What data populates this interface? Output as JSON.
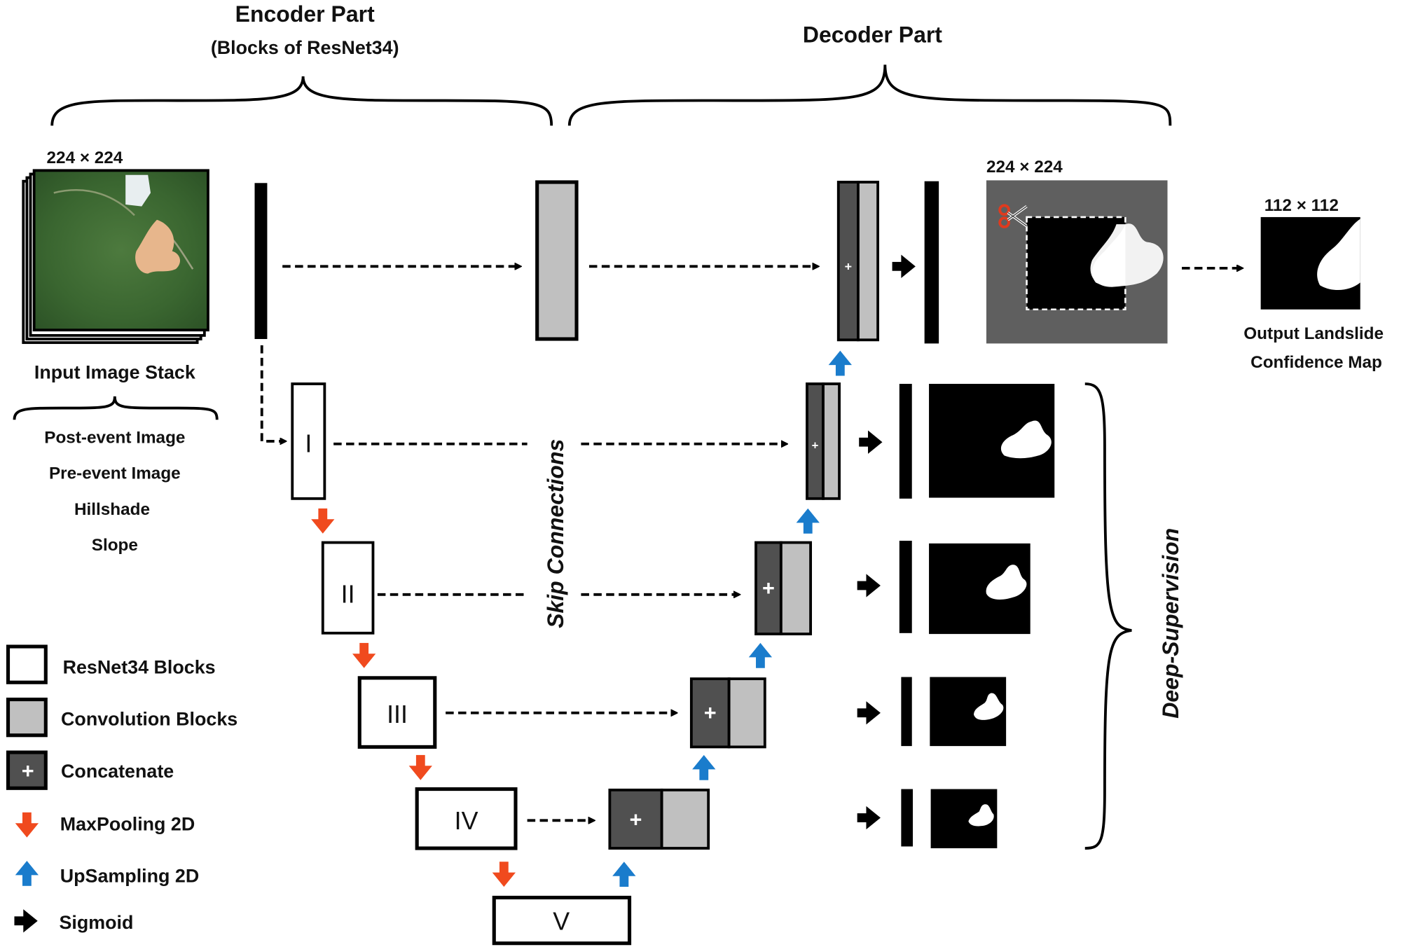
{
  "encoder": {
    "title": "Encoder Part",
    "subtitle": "(Blocks of ResNet34)"
  },
  "decoder": {
    "title": "Decoder Part"
  },
  "input": {
    "size": "224 × 224",
    "label": "Input Image Stack",
    "layers": [
      "Post-event Image",
      "Pre-event Image",
      "Hillshade",
      "Slope"
    ]
  },
  "encoder_blocks": [
    "I",
    "II",
    "III",
    "IV",
    "V"
  ],
  "skip_label": "Skip Connections",
  "deep_supervision_label": "Deep-Supervision",
  "crop": {
    "size": "224 × 224",
    "icon": "scissors-icon"
  },
  "output": {
    "size": "112 × 112",
    "label_line1": "Output Landslide",
    "label_line2": "Confidence Map"
  },
  "concat_symbol": "+",
  "legend": [
    {
      "label": "ResNet34 Blocks",
      "icon": "white-box"
    },
    {
      "label": "Convolution Blocks",
      "icon": "gray-box"
    },
    {
      "label": "Concatenate",
      "icon": "dark-box-plus"
    },
    {
      "label": "MaxPooling 2D",
      "icon": "red-down-arrow"
    },
    {
      "label": "UpSampling 2D",
      "icon": "blue-up-arrow"
    },
    {
      "label": "Sigmoid",
      "icon": "black-right-arrow"
    }
  ],
  "colors": {
    "maxpool": "#f04a1e",
    "upsample": "#1a7ccc",
    "conv": "#c0c0c0",
    "concat": "#505050",
    "crop_background": "#5f5f5f"
  }
}
